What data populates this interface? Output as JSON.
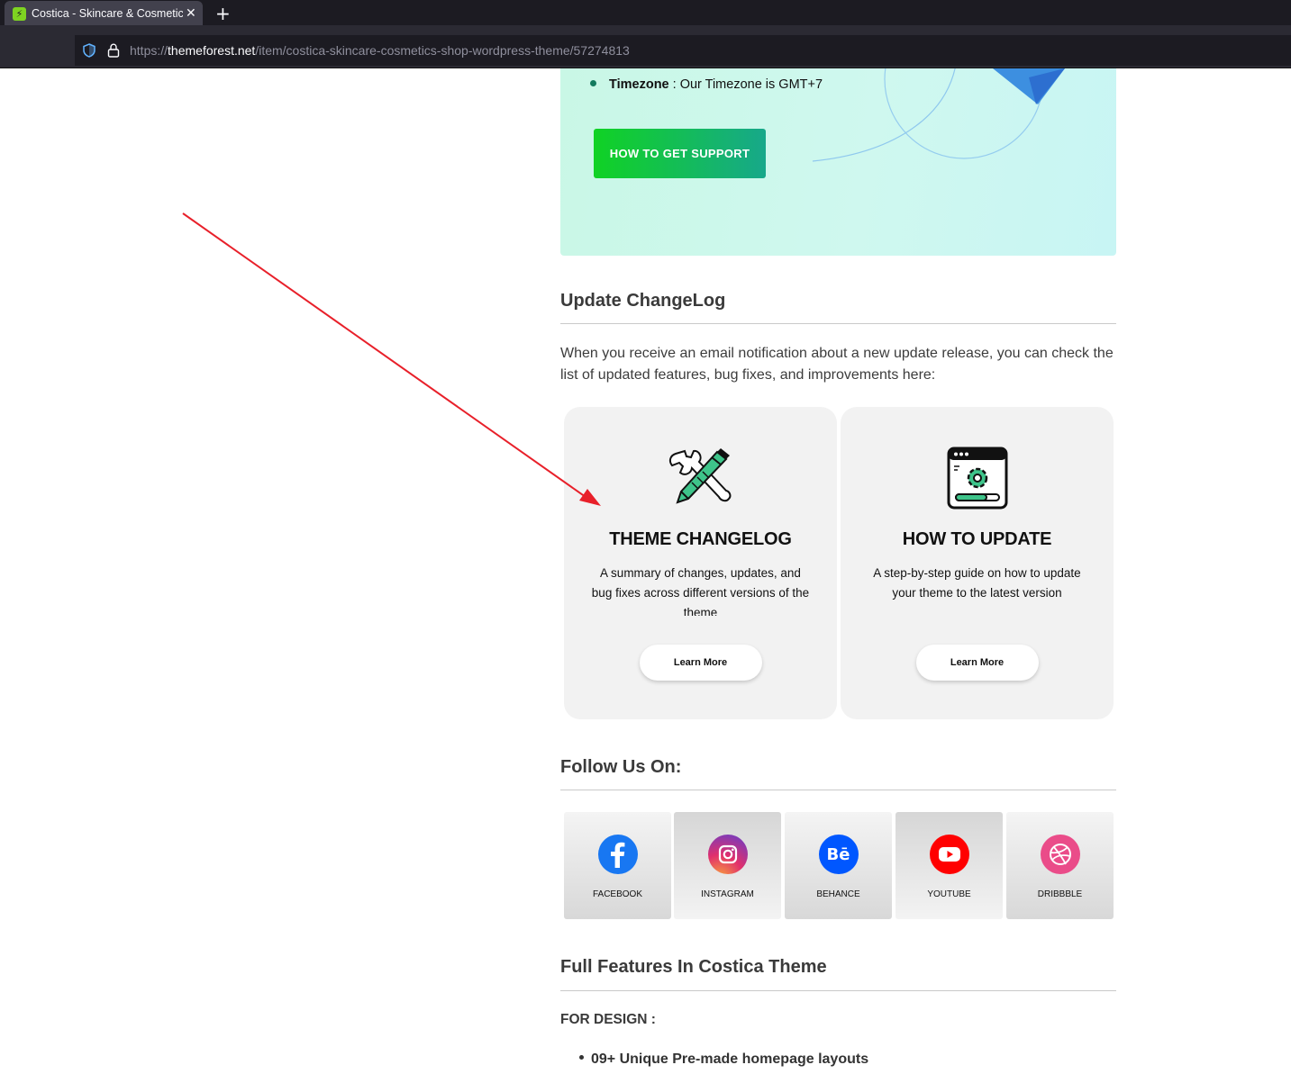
{
  "browser": {
    "tab_title": "Costica - Skincare & Cosmetics Shop WordPress Theme",
    "url_prefix": "https://",
    "url_domain": "themeforest.net",
    "url_path": "/item/costica-skincare-cosmetics-shop-wordpress-theme/57274813"
  },
  "support": {
    "timezone_label": "Timezone",
    "timezone_text": " : Our Timezone is GMT+7",
    "button_label": "HOW TO GET SUPPORT"
  },
  "changelog": {
    "heading": "Update ChangeLog",
    "intro": "When you receive an email notification about a new update release, you can check the list of updated features, bug fixes, and improvements here:",
    "cards": [
      {
        "title": "THEME CHANGELOG",
        "description": "A summary of changes, updates, and bug fixes across different versions of the theme",
        "button": "Learn More",
        "icon": "tools-icon"
      },
      {
        "title": "HOW TO UPDATE",
        "description": "A step-by-step guide on how to update your theme to the latest version",
        "button": "Learn More",
        "icon": "settings-window-icon"
      }
    ]
  },
  "follow": {
    "heading": "Follow Us On:",
    "items": [
      {
        "label": "FACEBOOK",
        "icon": "facebook-icon",
        "color": "#1877f2"
      },
      {
        "label": "INSTAGRAM",
        "icon": "instagram-icon",
        "color": "#c13584"
      },
      {
        "label": "BEHANCE",
        "icon": "behance-icon",
        "color": "#0057ff"
      },
      {
        "label": "YOUTUBE",
        "icon": "youtube-icon",
        "color": "#ff0000"
      },
      {
        "label": "DRIBBBLE",
        "icon": "dribbble-icon",
        "color": "#ea4c89"
      }
    ]
  },
  "features": {
    "heading": "Full Features In Costica Theme",
    "design_label": "FOR DESIGN :",
    "items": [
      "09+ Unique Pre-made homepage layouts"
    ]
  },
  "colors": {
    "annotation_arrow": "#e8202a",
    "support_button_start": "#10d224",
    "support_button_end": "#17a88a"
  }
}
